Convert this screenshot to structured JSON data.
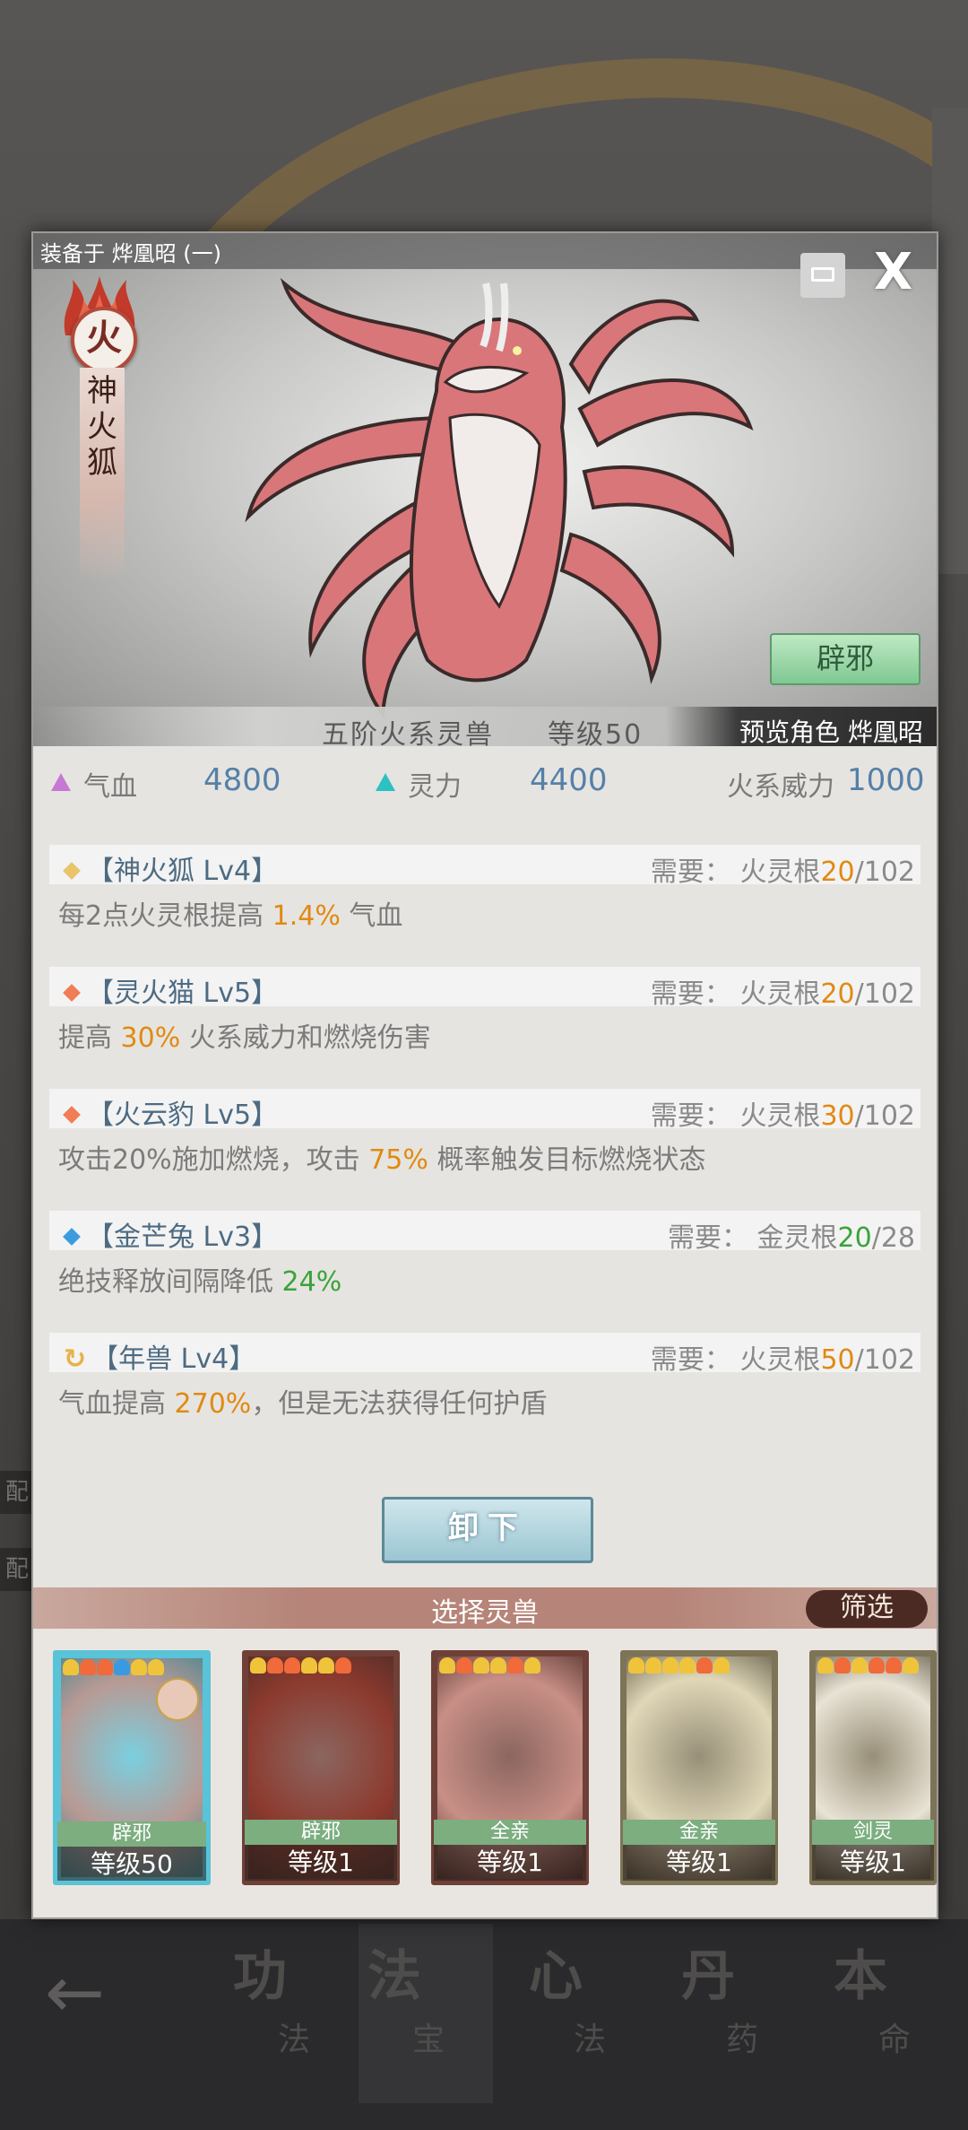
{
  "background": {
    "nav": [
      {
        "big": "功",
        "small": "法"
      },
      {
        "big": "法",
        "small": "宝"
      },
      {
        "big": "心",
        "small": "法"
      },
      {
        "big": "丹",
        "small": "药"
      },
      {
        "big": "本",
        "small": "命"
      }
    ],
    "left_strip_chars": [
      "配",
      "配"
    ]
  },
  "header": {
    "equipped_to": "装备于 烨凰昭 (一)",
    "close_label": "X",
    "element_char": "火",
    "beast_name": "神火狐",
    "bixie_label": "辟邪",
    "rank": "五阶火系灵兽",
    "level": "等级50",
    "preview": "预览角色 烨凰昭"
  },
  "stats": [
    {
      "label": "气血",
      "value": "4800",
      "color": "#c679d4"
    },
    {
      "label": "灵力",
      "value": "4400",
      "color": "#2cc1c2"
    },
    {
      "label": "火系威力",
      "value": "1000"
    }
  ],
  "skills": [
    {
      "title": "【神火狐 Lv4】",
      "icon_color": "#e8c56a",
      "req_label": "需要：",
      "req_root": "火灵根",
      "req_have": "20",
      "req_need": "/102",
      "have_color": "orange",
      "desc_pre": "每2点火灵根提高 ",
      "desc_hl": "1.4%",
      "desc_post": " 气血",
      "hl_color": "orange"
    },
    {
      "title": "【灵火猫 Lv5】",
      "icon_color": "#f07d55",
      "req_label": "需要：",
      "req_root": "火灵根",
      "req_have": "20",
      "req_need": "/102",
      "have_color": "orange",
      "desc_pre": "提高 ",
      "desc_hl": "30%",
      "desc_post": " 火系威力和燃烧伤害",
      "hl_color": "orange"
    },
    {
      "title": "【火云豹 Lv5】",
      "icon_color": "#f07d55",
      "req_label": "需要：",
      "req_root": "火灵根",
      "req_have": "30",
      "req_need": "/102",
      "have_color": "orange",
      "desc_pre": "攻击20%施加燃烧，攻击 ",
      "desc_hl": "75%",
      "desc_post": " 概率触发目标燃烧状态",
      "hl_color": "orange"
    },
    {
      "title": "【金芒兔 Lv3】",
      "icon_color": "#3b9de0",
      "req_label": "需要：",
      "req_root": "金灵根",
      "req_have": "20",
      "req_need": "/28",
      "have_color": "green",
      "desc_pre": "绝技释放间隔降低 ",
      "desc_hl": "24%",
      "desc_post": "",
      "hl_color": "green"
    },
    {
      "title": "【年兽 Lv4】",
      "icon_color": "#e8b14a",
      "req_label": "需要：",
      "req_root": "火灵根",
      "req_have": "50",
      "req_need": "/102",
      "have_color": "orange",
      "desc_pre": "气血提高 ",
      "desc_hl": "270%",
      "desc_post": "，但是无法获得任何护盾",
      "hl_color": "orange"
    }
  ],
  "unequip_label": "卸下",
  "select": {
    "title": "选择灵兽",
    "filter_label": "筛选"
  },
  "cards": [
    {
      "tag": "辟邪",
      "level": "等级50",
      "border": "#59c3d8",
      "tag_color": "#7cae80",
      "bg": "#b89a94",
      "stars": [
        "#f0c43a",
        "#f06a3a",
        "#f06a3a",
        "#3a9ae0",
        "#f0c43a",
        "#f0c43a"
      ],
      "selected": true
    },
    {
      "tag": "辟邪",
      "level": "等级1",
      "border": "#6e4038",
      "tag_color": "#7cae80",
      "bg": "#8c3a2e",
      "stars": [
        "#f0c43a",
        "#f06a3a",
        "#f06a3a",
        "#f0c43a",
        "#f0c43a",
        "#f06a3a"
      ]
    },
    {
      "tag": "全亲",
      "level": "等级1",
      "border": "#6e4038",
      "tag_color": "#7cae80",
      "bg": "#c88f86",
      "stars": [
        "#f0c43a",
        "#f06a3a",
        "#f0c43a",
        "#f0c43a",
        "#f06a3a",
        "#f0c43a"
      ]
    },
    {
      "tag": "金亲",
      "level": "等级1",
      "border": "#7d7356",
      "tag_color": "#7cae80",
      "bg": "#e0d7b8",
      "stars": [
        "#f0c43a",
        "#f0c43a",
        "#f0c43a",
        "#f0c43a",
        "#f06a3a",
        "#f0c43a"
      ]
    },
    {
      "tag": "剑灵",
      "level": "等级1",
      "border": "#7d7356",
      "tag_color": "#7cae80",
      "bg": "#e9e3d5",
      "stars": [
        "#f0c43a",
        "#f06a3a",
        "#f0c43a",
        "#f06a3a",
        "#f06a3a",
        "#f0c43a"
      ]
    }
  ]
}
